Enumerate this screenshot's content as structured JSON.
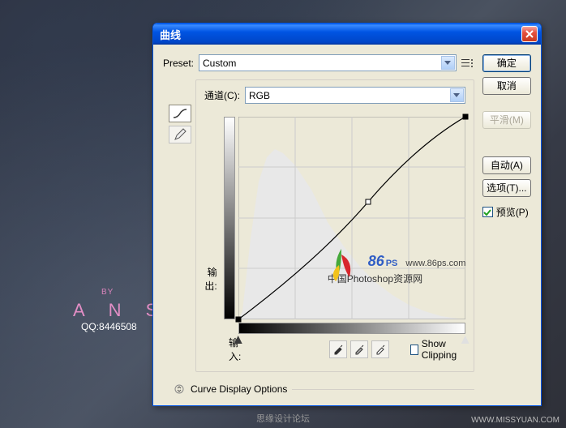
{
  "background": {
    "watermark_by": "BY",
    "watermark_name": "A N S",
    "watermark_qq_label": "QQ:",
    "watermark_qq": "8446508",
    "footer_main": "思缘设计论坛",
    "footer_url": "WWW.MISSYUAN.COM"
  },
  "dialog": {
    "title": "曲线",
    "preset_label": "Preset:",
    "preset_value": "Custom",
    "channel_label": "通道(C):",
    "channel_value": "RGB",
    "output_label": "输出:",
    "input_label": "输入:",
    "show_clipping": "Show Clipping",
    "curve_display_options": "Curve Display Options"
  },
  "buttons": {
    "ok": "确定",
    "cancel": "取消",
    "smooth": "平滑(M)",
    "auto": "自动(A)",
    "options": "选项(T)...",
    "preview": "预览(P)"
  },
  "watermark_logo": {
    "brand": "86",
    "brand_sub": "PS",
    "url": "www.86ps.com",
    "subtitle": "中国Photoshop资源网"
  }
}
